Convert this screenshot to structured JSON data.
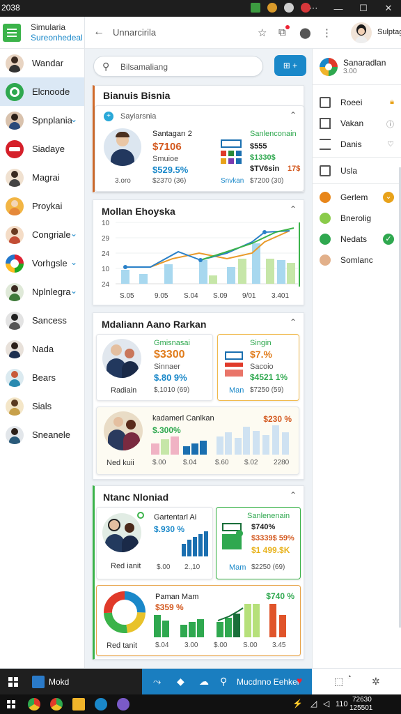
{
  "titlebar": {
    "time": "2038"
  },
  "sidebar": {
    "title1": "Simularia",
    "title2": "Sureonhedeal",
    "items": [
      {
        "label": "Wandar",
        "chevron": false
      },
      {
        "label": "Elcnoode",
        "chevron": false,
        "active": true
      },
      {
        "label": "Spnplania",
        "chevron": true
      },
      {
        "label": "Siadaye",
        "chevron": false
      },
      {
        "label": "Magrai",
        "chevron": false
      },
      {
        "label": "Proykai",
        "chevron": false
      },
      {
        "label": "Congriale",
        "chevron": true
      },
      {
        "label": "Vorhgsle",
        "chevron": true
      },
      {
        "label": "Nplnlegra",
        "chevron": true
      },
      {
        "label": "Sancess",
        "chevron": false
      },
      {
        "label": "Nada",
        "chevron": false
      },
      {
        "label": "Bears",
        "chevron": false
      },
      {
        "label": "Sials",
        "chevron": false
      },
      {
        "label": "Sneanele",
        "chevron": false
      }
    ]
  },
  "appbar": {
    "crumb": "Unnarcirila",
    "user_name": "Sulptag"
  },
  "search": {
    "placeholder": "Bilsamaliang",
    "add_label": "⊞ +"
  },
  "section1": {
    "title": "Bianuis Bisnia",
    "sub_title": "Sayiarsnia",
    "card_a": {
      "label": "Santagarı 2",
      "value": "$7106",
      "label2": "Smuioe",
      "value2": "$529.5%",
      "foot_left": "3.oro",
      "foot_right": "$2370 (36)"
    },
    "card_b": {
      "label": "Sanlenconain",
      "v1": "$555",
      "v2": "$1330$",
      "v3": "$TV6sin",
      "v3b": "17$",
      "foot_left": "Snvkan",
      "foot_right": "$7200 (30)"
    }
  },
  "section2": {
    "title": "Mollan Ehoyska",
    "y_ticks": [
      "10",
      "29",
      "24",
      "10",
      "24"
    ],
    "x_ticks": [
      "S.05",
      "9.05",
      "S.04",
      "S.09",
      "9/01",
      "3.401"
    ]
  },
  "section3": {
    "title": "Mdaliann Aano Rarkan",
    "card_a": {
      "label": "Gmisnasai",
      "value": "$3300",
      "label2": "Sinnaer",
      "value2": "$.80 9%",
      "foot_left": "Radiain",
      "foot_right": "$,1010 (69)"
    },
    "card_b": {
      "label": "Singin",
      "v1": "$7.%",
      "v2": "Sacoio",
      "v3": "$4521 1%",
      "foot_left": "Man",
      "foot_right": "$7250 (59)"
    },
    "card_c": {
      "label": "kadamerl Canlkan",
      "value": "$.300%",
      "right_value": "$230 %",
      "foot_left": "Ned kuii",
      "ticks": [
        "$.00",
        "$.04",
        "$.60",
        "$.02",
        "2280"
      ]
    }
  },
  "section4": {
    "title": "Ntanc Nloniad",
    "card_a": {
      "label": "Gartentarl Ai",
      "value": "$.930 %",
      "foot_left": "Red ianit",
      "ticks": [
        "$.00",
        "2.,10"
      ]
    },
    "card_b": {
      "label": "Sanlenenain",
      "v1": "$740%",
      "v2": "$3339$ 59%",
      "v3": "$1 499.$K",
      "foot_left": "Mam",
      "foot_right": "$2250 (69)"
    },
    "card_c": {
      "label": "Paman Mam",
      "value": "$359 %",
      "right_value": "$740 %",
      "foot_left": "Red tanit",
      "ticks": [
        "$.04",
        "3.00",
        "$.00",
        "S.00",
        "3.45"
      ]
    }
  },
  "rpanel": {
    "head_title": "Sanaradlan",
    "head_sub": "3.00",
    "items": [
      {
        "label": "Roeei"
      },
      {
        "label": "Vakan"
      },
      {
        "label": "Danis"
      },
      {
        "label": "Usla"
      },
      {
        "label": "Gerlem"
      },
      {
        "label": "Bnerolig"
      },
      {
        "label": "Nedats"
      },
      {
        "label": "Somlanc"
      }
    ]
  },
  "bottombar": {
    "app_label": "Mokd",
    "center_label": "Mucdnno Eehkei"
  },
  "taskbar": {
    "tray_num": "110",
    "time": "72630",
    "date": "125501"
  },
  "colors": {
    "accent": "#1a88c9",
    "green": "#3bb34a",
    "orange": "#e07b1a"
  }
}
